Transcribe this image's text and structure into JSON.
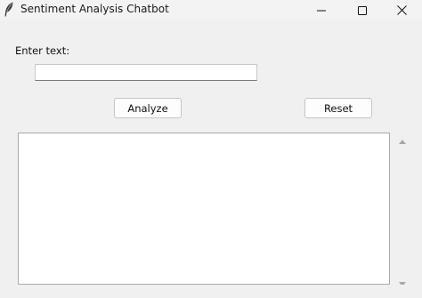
{
  "window": {
    "title": "Sentiment Analysis Chatbot",
    "app_icon": "feather-icon",
    "controls": {
      "minimize_icon": "minimize-icon",
      "maximize_icon": "maximize-icon",
      "close_icon": "close-icon"
    }
  },
  "form": {
    "input_label": "Enter text:",
    "input_value": "",
    "input_placeholder": ""
  },
  "buttons": {
    "analyze_label": "Analyze",
    "reset_label": "Reset"
  },
  "output": {
    "text": "",
    "scroll_up_icon": "triangle-up-icon",
    "scroll_down_icon": "triangle-down-icon"
  },
  "colors": {
    "window_bg": "#f0f0f0",
    "field_bg": "#ffffff"
  }
}
